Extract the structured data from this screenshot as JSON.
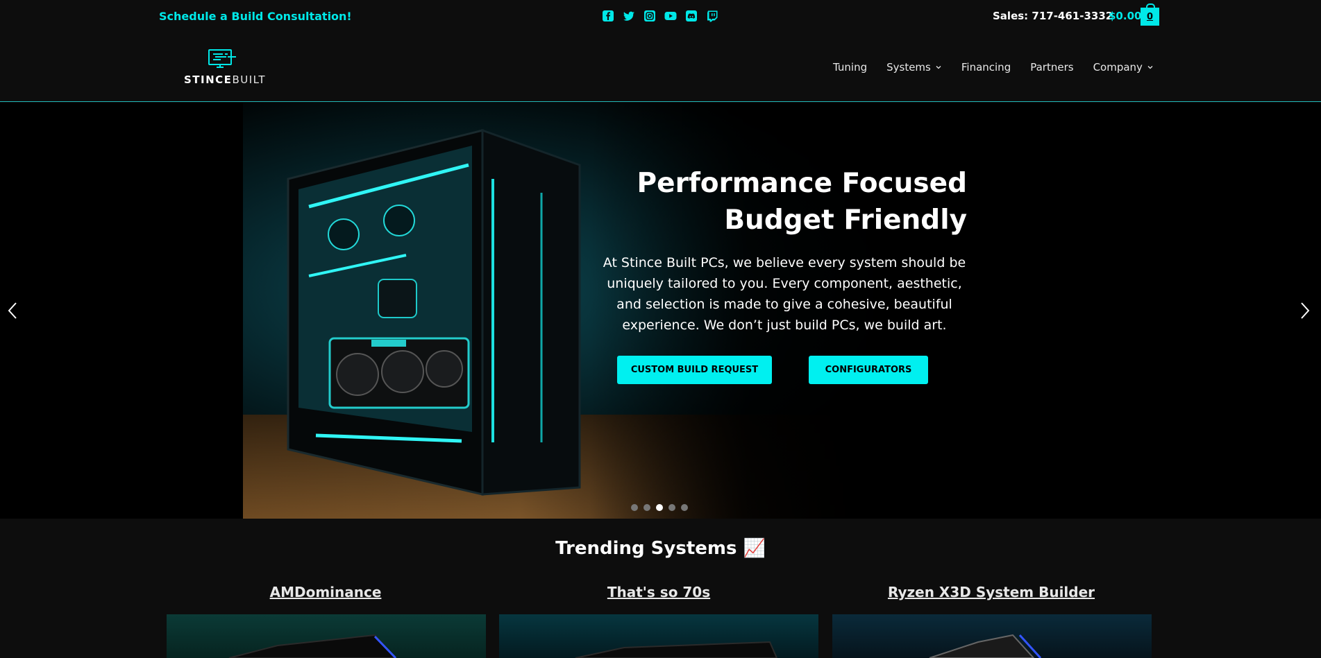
{
  "topbar": {
    "consult_label": "Schedule a Build Consultation!",
    "socials": [
      "facebook-icon",
      "twitter-icon",
      "instagram-icon",
      "youtube-icon",
      "discord-icon",
      "twitch-icon"
    ],
    "sales_label": "Sales: 717-461-3332",
    "cart_total": "$0.00",
    "cart_count": "0"
  },
  "header": {
    "logo_part1": "STINCE",
    "logo_part2": "BUILT",
    "nav": [
      {
        "label": "Tuning"
      },
      {
        "label": "Systems"
      },
      {
        "label": "Financing"
      },
      {
        "label": "Partners"
      },
      {
        "label": "Company"
      }
    ]
  },
  "hero": {
    "title_line1": "Performance Focused",
    "title_line2": "Budget Friendly",
    "text": "At Stince Built PCs, we believe every system should be uniquely tailored to you. Every component, aesthetic, and selection is made to give a cohesive, beautiful experience. We don’t just build PCs, we build art.",
    "button1": "CUSTOM BUILD REQUEST",
    "button2": "CONFIGURATORS",
    "slides_total": 5,
    "active_slide": 3
  },
  "trending": {
    "title": "Trending Systems 📈",
    "cards": [
      {
        "title": "AMDominance"
      },
      {
        "title": "That's so 70s"
      },
      {
        "title": "Ryzen X3D System Builder"
      }
    ]
  },
  "colors": {
    "accent": "#00e8e8",
    "background": "#0d0d0d"
  }
}
